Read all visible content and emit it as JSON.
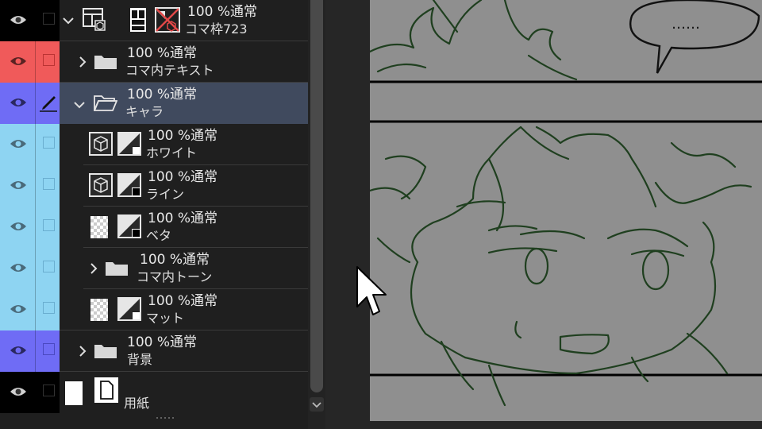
{
  "layers": [
    {
      "opacity_blend": "100 %通常",
      "name": "コマ枠723"
    },
    {
      "opacity_blend": "100 %通常",
      "name": "コマ内テキスト"
    },
    {
      "opacity_blend": "100 %通常",
      "name": "キャラ"
    },
    {
      "opacity_blend": "100 %通常",
      "name": "ホワイト"
    },
    {
      "opacity_blend": "100 %通常",
      "name": "ライン"
    },
    {
      "opacity_blend": "100 %通常",
      "name": "ベタ"
    },
    {
      "opacity_blend": "100 %通常",
      "name": "コマ内トーン"
    },
    {
      "opacity_blend": "100 %通常",
      "name": "マット"
    },
    {
      "opacity_blend": "100 %通常",
      "name": "背景"
    },
    {
      "opacity_blend": "",
      "name": "用紙"
    }
  ],
  "canvas": {
    "speech_bubble_text": "……"
  },
  "colors": {
    "red_label": "#f05a5a",
    "blue_label": "#6f6cf5",
    "cyan_label": "#8ed4f2",
    "selected_row": "#404a5e",
    "ink_line": "#1f3f1f",
    "canvas_bg": "#8f8f8f"
  },
  "icons": [
    "eye-icon",
    "pen-icon",
    "folder-icon",
    "folder-open-icon",
    "chevron-right-icon",
    "chevron-down-icon",
    "frame-folder-icon",
    "3d-cube-icon",
    "layer-mask-icon",
    "paper-icon",
    "mouse-pointer-icon"
  ]
}
